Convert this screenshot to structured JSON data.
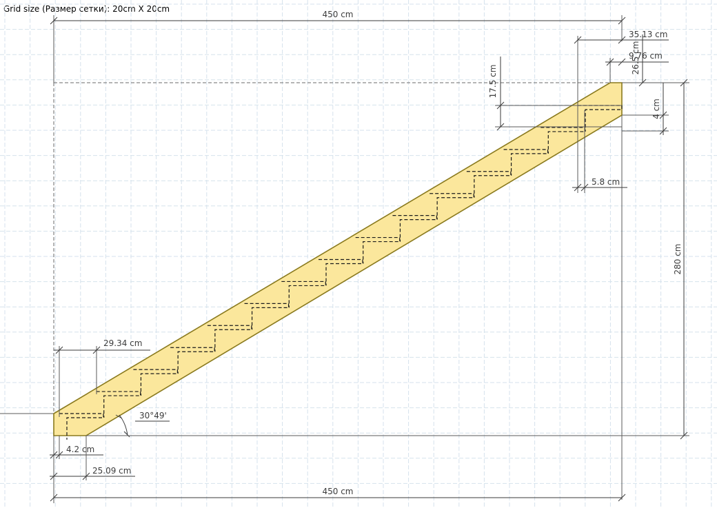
{
  "header": {
    "grid_size_label": "Grid size (Размер сетки): 20cm X 20cm"
  },
  "colors": {
    "stringer_fill": "#fbe79c",
    "stringer_stroke": "#8a7a1e",
    "grid_line": "#d5e2ec",
    "dimension_line": "#3a3a3a"
  },
  "dimensions": {
    "total_width_top": "450 cm",
    "total_width_bottom": "450 cm",
    "total_height": "280 cm",
    "tread_overhang_top": "35.13 cm",
    "tread_top_setback": "9.76 cm",
    "top_rise_fragment": "26.5 cm",
    "step_rise": "17.5 cm",
    "tread_thickness": "4 cm",
    "riser_offset": "5.8 cm",
    "step_going": "29.34 cm",
    "stringer_angle": "30°49'",
    "bottom_offset": "4.2 cm",
    "bottom_stringer_cut": "25.09 cm"
  },
  "stair": {
    "step_count": 15,
    "total_run_cm": 450,
    "total_rise_cm": 280
  }
}
